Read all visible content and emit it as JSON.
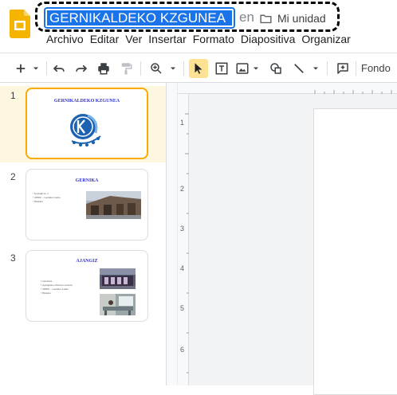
{
  "header": {
    "doc_title": "GERNIKALDEKO KZGUNEA",
    "location_prefix": "en",
    "folder_label": "Mi unidad"
  },
  "menu": [
    "Archivo",
    "Editar",
    "Ver",
    "Insertar",
    "Formato",
    "Diapositiva",
    "Organizar"
  ],
  "toolbar": {
    "background_label": "Fondo",
    "icons": [
      "add-icon",
      "dropdown-caret-icon",
      "undo-icon",
      "redo-icon",
      "print-icon",
      "paint-format-icon",
      "zoom-icon",
      "select-cursor-icon",
      "text-box-icon",
      "image-icon",
      "shape-icon",
      "line-icon",
      "add-comment-icon"
    ],
    "active_tool": "select-cursor-icon"
  },
  "slides": [
    {
      "number": "1",
      "title": "GERNIKALDEKO KZGUNEA",
      "selected": true
    },
    {
      "number": "2",
      "title": "GERNIKA",
      "bullets": [
        "Ipazagirre, 2",
        "48300 – Gernika Lumo",
        "Bizkaia"
      ]
    },
    {
      "number": "3",
      "title": "AJANGIZ",
      "bullets": [
        "eskolena",
        "Ajangizko elizaren ondoan",
        "48300 – Gernika-Lumo",
        "Bizkaia"
      ]
    }
  ],
  "ruler": {
    "vertical_labels": [
      "1",
      "2",
      "3",
      "4",
      "5",
      "6"
    ]
  },
  "colors": {
    "accent": "#1a73e8",
    "selected_slide_border": "#f9ab00",
    "selected_slide_bg": "#fef7e0",
    "slide_title": "#3333cc",
    "logo_yellow": "#f4b400"
  }
}
